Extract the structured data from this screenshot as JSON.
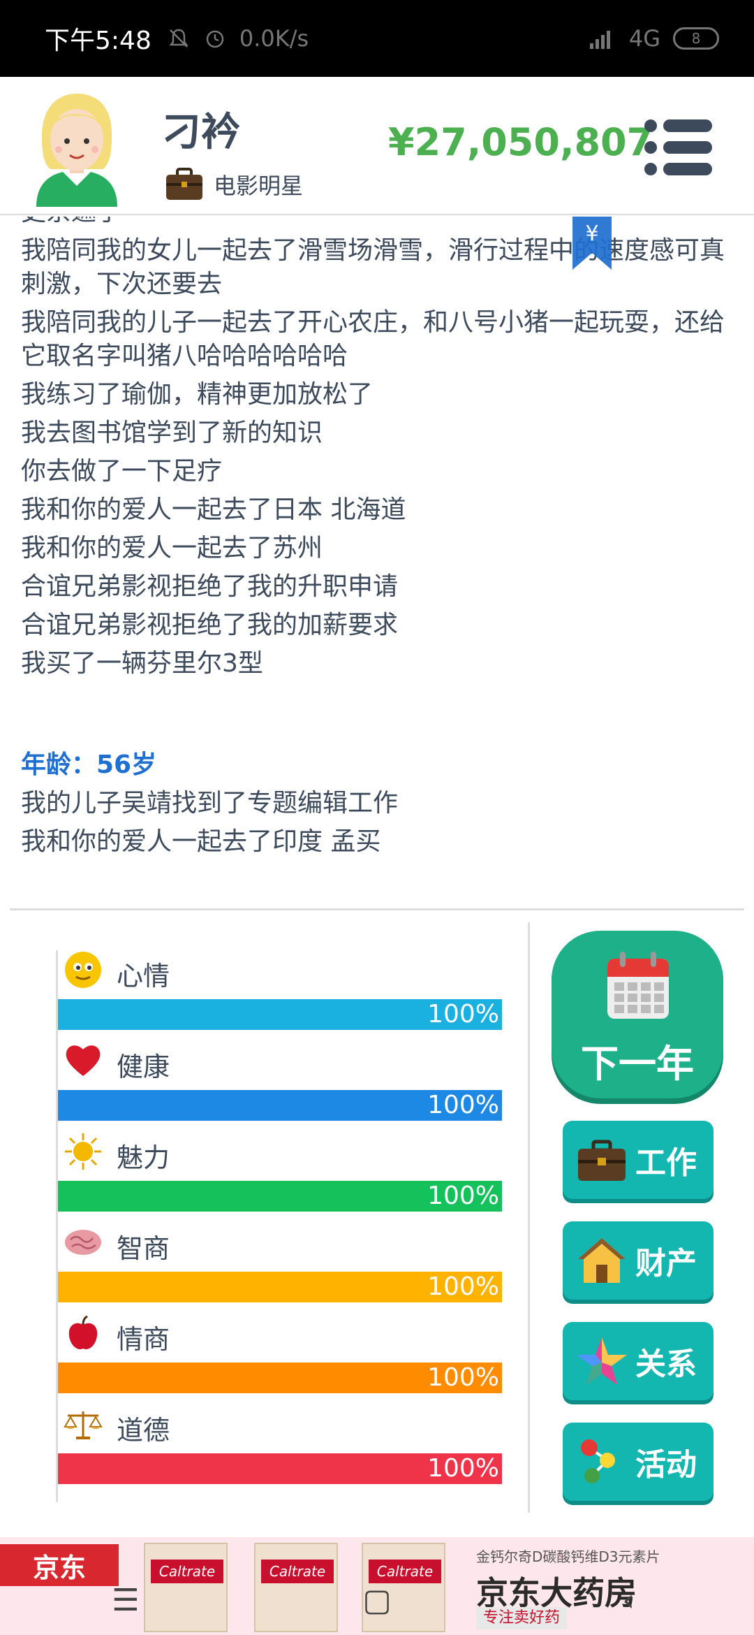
{
  "status_bar": {
    "time": "下午5:48",
    "speed": "0.0K/s",
    "network": "4G",
    "battery": "8"
  },
  "header": {
    "player_name": "刁衿",
    "job": "电影明星",
    "money": "¥27,050,807"
  },
  "log": {
    "partial_top_line": "更余遮了",
    "entries": [
      "我陪同我的女儿一起去了滑雪场滑雪，滑行过程中的速度感可真刺激，下次还要去",
      "我陪同我的儿子一起去了开心农庄，和八号小猪一起玩耍，还给它取名字叫猪八哈哈哈哈哈哈",
      "我练习了瑜伽，精神更加放松了",
      "我去图书馆学到了新的知识",
      "你去做了一下足疗",
      "我和你的爱人一起去了日本 北海道",
      "我和你的爱人一起去了苏州",
      "合谊兄弟影视拒绝了我的升职申请",
      "合谊兄弟影视拒绝了我的加薪要求",
      "我买了一辆芬里尔3型"
    ],
    "age_label": "年龄：56岁",
    "entries_after_age": [
      "我的儿子吴靖找到了专题编辑工作",
      "我和你的爱人一起去了印度 孟买"
    ],
    "yen_flag": "¥"
  },
  "stats": [
    {
      "label": "心情",
      "value": 100,
      "display": "100%",
      "color": "#1ab0e0",
      "icon": "smiley-icon"
    },
    {
      "label": "健康",
      "value": 100,
      "display": "100%",
      "color": "#1e88e5",
      "icon": "heart-icon"
    },
    {
      "label": "魅力",
      "value": 100,
      "display": "100%",
      "color": "#14c15a",
      "icon": "sun-icon"
    },
    {
      "label": "智商",
      "value": 100,
      "display": "100%",
      "color": "#ffb300",
      "icon": "brain-icon"
    },
    {
      "label": "情商",
      "value": 100,
      "display": "100%",
      "color": "#ff8c00",
      "icon": "apple-icon"
    },
    {
      "label": "道德",
      "value": 100,
      "display": "100%",
      "color": "#ef3349",
      "icon": "scales-icon"
    }
  ],
  "buttons": {
    "next_year": "下一年",
    "work": "工作",
    "property": "财产",
    "relations": "关系",
    "activities": "活动"
  },
  "ad": {
    "brand": "京东",
    "product_tag": "Caltrate",
    "small_text": "金钙尔奇D碳酸钙维D3元素片",
    "title": "京东大药房",
    "slogan": "专注卖好药"
  },
  "navbar": {
    "menu": "☰",
    "home": "▢",
    "back": "‹"
  }
}
